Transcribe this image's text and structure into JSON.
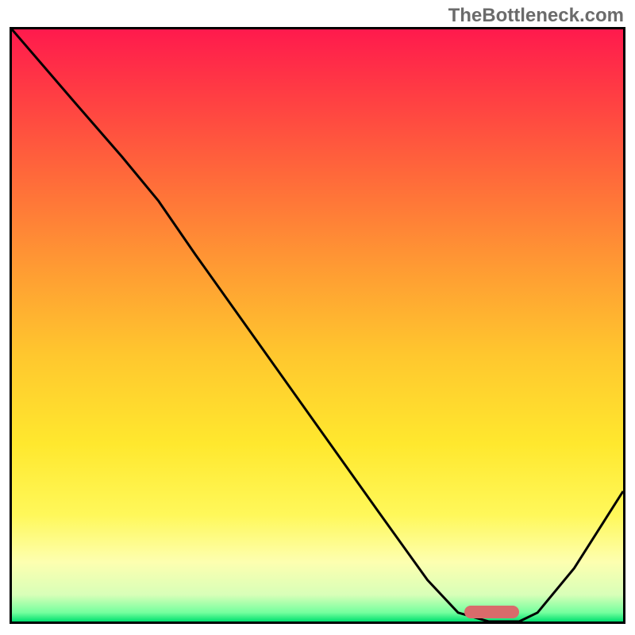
{
  "watermark": "TheBottleneck.com",
  "chart_data": {
    "type": "line",
    "title": "",
    "xlabel": "",
    "ylabel": "",
    "xlim": [
      0,
      100
    ],
    "ylim": [
      0,
      100
    ],
    "grid": false,
    "legend": false,
    "gradient_stops": [
      {
        "pos": 0.0,
        "color": "#ff1a4d"
      },
      {
        "pos": 0.1,
        "color": "#ff3a44"
      },
      {
        "pos": 0.25,
        "color": "#ff6a3a"
      },
      {
        "pos": 0.4,
        "color": "#ff9a33"
      },
      {
        "pos": 0.55,
        "color": "#ffc72e"
      },
      {
        "pos": 0.7,
        "color": "#ffe82e"
      },
      {
        "pos": 0.82,
        "color": "#fff85a"
      },
      {
        "pos": 0.9,
        "color": "#fdffb0"
      },
      {
        "pos": 0.955,
        "color": "#d8ffb8"
      },
      {
        "pos": 0.985,
        "color": "#74ff9e"
      },
      {
        "pos": 1.0,
        "color": "#00e070"
      }
    ],
    "series": [
      {
        "name": "bottleneck-curve",
        "color": "#000000",
        "width": 3,
        "points_percent": [
          {
            "x": 0.0,
            "y": 100.0
          },
          {
            "x": 10.0,
            "y": 88.0
          },
          {
            "x": 18.0,
            "y": 78.5
          },
          {
            "x": 24.0,
            "y": 71.0
          },
          {
            "x": 30.0,
            "y": 62.0
          },
          {
            "x": 40.0,
            "y": 47.5
          },
          {
            "x": 50.0,
            "y": 33.0
          },
          {
            "x": 60.0,
            "y": 18.5
          },
          {
            "x": 68.0,
            "y": 7.0
          },
          {
            "x": 73.0,
            "y": 1.5
          },
          {
            "x": 78.0,
            "y": 0.0
          },
          {
            "x": 83.0,
            "y": 0.0
          },
          {
            "x": 86.0,
            "y": 1.5
          },
          {
            "x": 92.0,
            "y": 9.0
          },
          {
            "x": 100.0,
            "y": 22.0
          }
        ]
      }
    ],
    "marker": {
      "name": "optimal-range",
      "x_center_percent": 78.5,
      "y_center_percent": 1.6,
      "width_percent": 9.0,
      "height_percent": 2.2,
      "color": "#d96b6b"
    }
  }
}
